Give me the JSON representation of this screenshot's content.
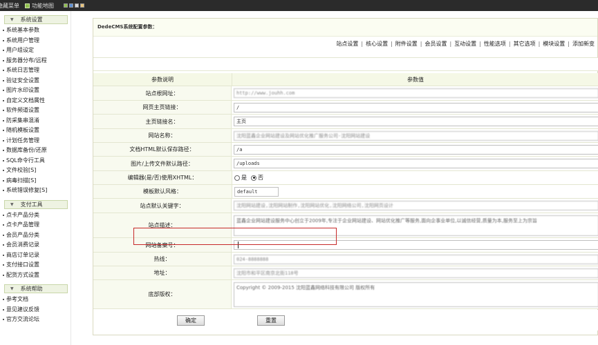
{
  "topbar": {
    "hide_menu": "隐藏菜单",
    "site_map": "功能地图"
  },
  "sidebar": {
    "groups": [
      {
        "title": "系统设置",
        "items": [
          "系统基本参数",
          "系统用户管理",
          "用户组设定",
          "服务器分布/远程",
          "系统日志管理",
          "验证安全设置",
          "图片水印设置",
          "自定义文档属性",
          "软件频道设置",
          "防采集串混淆",
          "随机模板设置",
          "计划任务管理",
          "数据库备份/还原",
          "SQL命令行工具",
          "文件校验[S]",
          "病毒扫描[S]",
          "系统错误修复[S]"
        ]
      },
      {
        "title": "支付工具",
        "items": [
          "点卡产品分类",
          "点卡产品管理",
          "会员产品分类",
          "会员消费记录",
          "商店订单记录",
          "支付接口设置",
          "配货方式设置"
        ]
      },
      {
        "title": "系统帮助",
        "items": [
          "参考文档",
          "意见建议反馈",
          "官方交流论坛"
        ]
      }
    ]
  },
  "panel": {
    "title": "DedeCMS系统配置参数：",
    "tabs": [
      "站点设置",
      "核心设置",
      "附件设置",
      "会员设置",
      "互动设置",
      "性能选项",
      "其它选项",
      "模块设置",
      "添加新变"
    ]
  },
  "form": {
    "header_label": "参数说明",
    "header_value": "参数值",
    "site_url": {
      "label": "站点根网址：",
      "value": "http://www.jouhh.com"
    },
    "home_link": {
      "label": "网页主页链接：",
      "value": "/"
    },
    "home_name": {
      "label": "主页链接名：",
      "value": "主页"
    },
    "site_name": {
      "label": "网站名称：",
      "value": "沈阳蓝鑫企业网站建设及网站优化推广服务公司-沈阳网站建设"
    },
    "html_path": {
      "label": "文档HTML默认保存路径：",
      "value": "/a"
    },
    "upload_path": {
      "label": "图片/上传文件默认路径：",
      "value": "/uploads"
    },
    "editor_xhtml": {
      "label": "编辑器(是/否)使用XHTML：",
      "options": [
        "是",
        "否"
      ],
      "selected": "否"
    },
    "template_style": {
      "label": "模板默认风格：",
      "value": "default"
    },
    "keywords": {
      "label": "站点默认关键字：",
      "value": "沈阳网站建设,沈阳网站制作,沈阳网站优化,沈阳网络公司,沈阳网页设计"
    },
    "description": {
      "label": "站点描述：",
      "value": "蓝鑫企业网站建设服务中心创立于2009年,专注于企业网站建设、网站优化推广等服务,面向企事业单位,以诚信经营,质量为本,服务至上为宗旨"
    },
    "icp": {
      "label": "网站备案号：",
      "value": ""
    },
    "hotline": {
      "label": "热线：",
      "value": "024-8888888"
    },
    "address": {
      "label": "地址：",
      "value": "沈阳市和平区南京北街118号"
    },
    "copyright": {
      "label": "底部版权：",
      "value": "Copyright © 2009-2015 沈阳蓝鑫网络科技有限公司 版权所有"
    }
  },
  "buttons": {
    "confirm": "确定",
    "reset": "重置"
  },
  "colors": {
    "highlight": "#c62828",
    "label_bg": "#f8faef",
    "topbar": "#2b2b2b"
  }
}
